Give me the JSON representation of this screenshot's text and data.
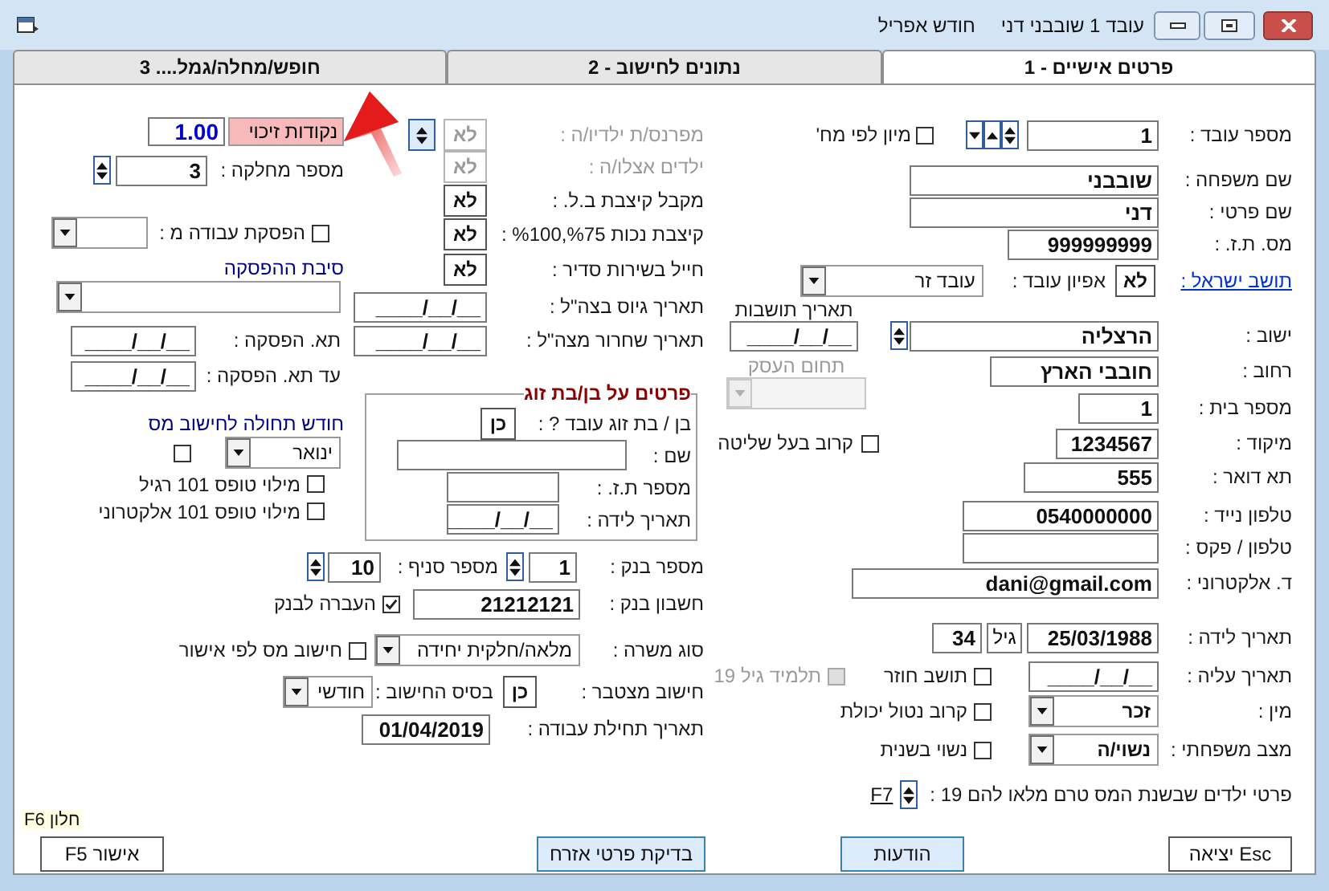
{
  "window": {
    "employee": "עובד 1 שובבני דני",
    "month": "חודש אפריל"
  },
  "tabs": [
    {
      "label": "פרטים אישיים - 1",
      "selected": true
    },
    {
      "label": "נתונים לחישוב - 2",
      "selected": false
    },
    {
      "label": "חופש/מחלה/גמל.... 3",
      "selected": false
    }
  ],
  "personal": {
    "employee_number": {
      "label": "מספר עובד :",
      "value": "1"
    },
    "sort_by_department": {
      "label": "מיון לפי מח'",
      "checked": false
    },
    "last_name": {
      "label": "שם משפחה :",
      "value": "שובבני"
    },
    "first_name": {
      "label": "שם פרטי :",
      "value": "דני"
    },
    "id_number": {
      "label": "מס. ת.ז. :",
      "value": "999999999"
    },
    "israeli_resident": {
      "label": "תושב ישראל :",
      "value": "לא"
    },
    "employee_type": {
      "label": "אפיון עובד :",
      "value": "עובד זר"
    },
    "city": {
      "label": "ישוב :",
      "value": "הרצליה"
    },
    "residency_date": {
      "label": "תאריך תושבות",
      "value": "__/__/____"
    },
    "street": {
      "label": "רחוב :",
      "value": "חובבי הארץ"
    },
    "business_field": {
      "label": "תחום העסק",
      "disabled": true
    },
    "house_number": {
      "label": "מספר בית :",
      "value": "1"
    },
    "zip": {
      "label": "מיקוד :",
      "value": "1234567"
    },
    "controlling_relative": {
      "label": "קרוב בעל שליטה",
      "checked": false
    },
    "po_box": {
      "label": "תא דואר :",
      "value": "555"
    },
    "mobile": {
      "label": "טלפון נייד :",
      "value": "0540000000"
    },
    "phone_fax": {
      "label": "טלפון / פקס :"
    },
    "email": {
      "label": "ד. אלקטרוני :",
      "value": "dani@gmail.com"
    },
    "birth_date": {
      "label": "תאריך לידה :",
      "value": "25/03/1988"
    },
    "age": {
      "label": "גיל",
      "value": "34"
    },
    "immigration_date": {
      "label": "תאריך עליה :",
      "value": "__/__/____"
    },
    "returning_resident": {
      "label": "תושב חוזר",
      "checked": false
    },
    "student_19": {
      "label": "תלמיד גיל 19",
      "checked": false,
      "disabled": true
    },
    "gender": {
      "label": "מין :",
      "value": "זכר"
    },
    "disabled_relative": {
      "label": "קרוב נטול יכולת",
      "checked": false
    },
    "marital_status": {
      "label": "מצב משפחתי :",
      "value": "נשוי/ה"
    },
    "remarried": {
      "label": "נשוי בשנית",
      "checked": false
    },
    "children": {
      "label": "פרטי ילדים שבשנת המס טרם מלאו להם 19 :",
      "link": "F7"
    }
  },
  "benefits": [
    {
      "label": "מפרנס/ת ילדיו/ה :",
      "value": "לא",
      "disabled": true
    },
    {
      "label": "ילדים אצלו/ה :",
      "value": "לא",
      "disabled": true
    },
    {
      "label": "מקבל קיצבת ב.ל. :",
      "value": "לא",
      "disabled": false
    },
    {
      "label": "קיצבת נכות %75,%100 :",
      "value": "לא",
      "disabled": false
    },
    {
      "label": "חייל בשירות סדיר :",
      "value": "לא",
      "disabled": false
    }
  ],
  "army_dates": [
    {
      "label": "תאריך גיוס בצה\"ל :",
      "value": "__/__/____"
    },
    {
      "label": "תאריך שחרור מצה\"ל :",
      "value": "__/__/____"
    }
  ],
  "spouse": {
    "title": "פרטים על בן/בת זוג",
    "works": {
      "label": "בן / בת זוג עובד ? :",
      "value": "כן"
    },
    "name": {
      "label": "שם :"
    },
    "id_number": {
      "label": "מספר ת.ז. :"
    },
    "birth_date": {
      "label": "תאריך לידה :",
      "value": "__/__/____"
    }
  },
  "left": {
    "credit_points": {
      "label": "נקודות זיכוי",
      "value": "1.00"
    },
    "department": {
      "label": "מספר מחלקה :",
      "value": "3"
    },
    "work_stop": {
      "label": "הפסקת עבודה מ :",
      "checked": false
    },
    "stop_reason": {
      "label": "סיבת ההפסקה"
    },
    "stop_date": {
      "label": "תא. הפסקה :",
      "value": "__/__/____"
    },
    "until_stop_date": {
      "label": "עד תא. הפסקה :",
      "value": "__/__/____"
    },
    "tax_month": {
      "label": "חודש תחולה לחישוב מס",
      "value": "ינואר",
      "checked": false
    },
    "forms": [
      {
        "label": "מילוי טופס 101 רגיל",
        "checked": false
      },
      {
        "label": "מילוי טופס 101 אלקטרוני",
        "checked": false
      }
    ]
  },
  "bank": {
    "bank_number": {
      "label": "מספר בנק :",
      "value": "1"
    },
    "branch": {
      "label": "מספר סניף :",
      "value": "10"
    },
    "account": {
      "label": "חשבון בנק :",
      "value": "21212121"
    },
    "transfer": {
      "label": "העברה לבנק",
      "checked": true
    },
    "job_type": {
      "label": "סוג משרה :",
      "value": "מלאה/חלקית יחידה"
    },
    "tax_by_approval": {
      "label": "חישוב מס לפי אישור",
      "checked": false
    },
    "cumulative": {
      "label": "חישוב מצטבר :",
      "value": "כן"
    },
    "basis": {
      "label": "בסיס החישוב :",
      "value": "חודשי"
    },
    "start_date": {
      "label": "תאריך תחילת עבודה :",
      "value": "01/04/2019"
    }
  },
  "hint": "חלון F6",
  "buttons": [
    {
      "label": "Esc יציאה",
      "focused": false
    },
    {
      "label": "הודעות",
      "focused": true
    },
    {
      "label": "בדיקת פרטי אזרח",
      "focused": true
    },
    {
      "label": "אישור F5",
      "focused": false
    }
  ]
}
